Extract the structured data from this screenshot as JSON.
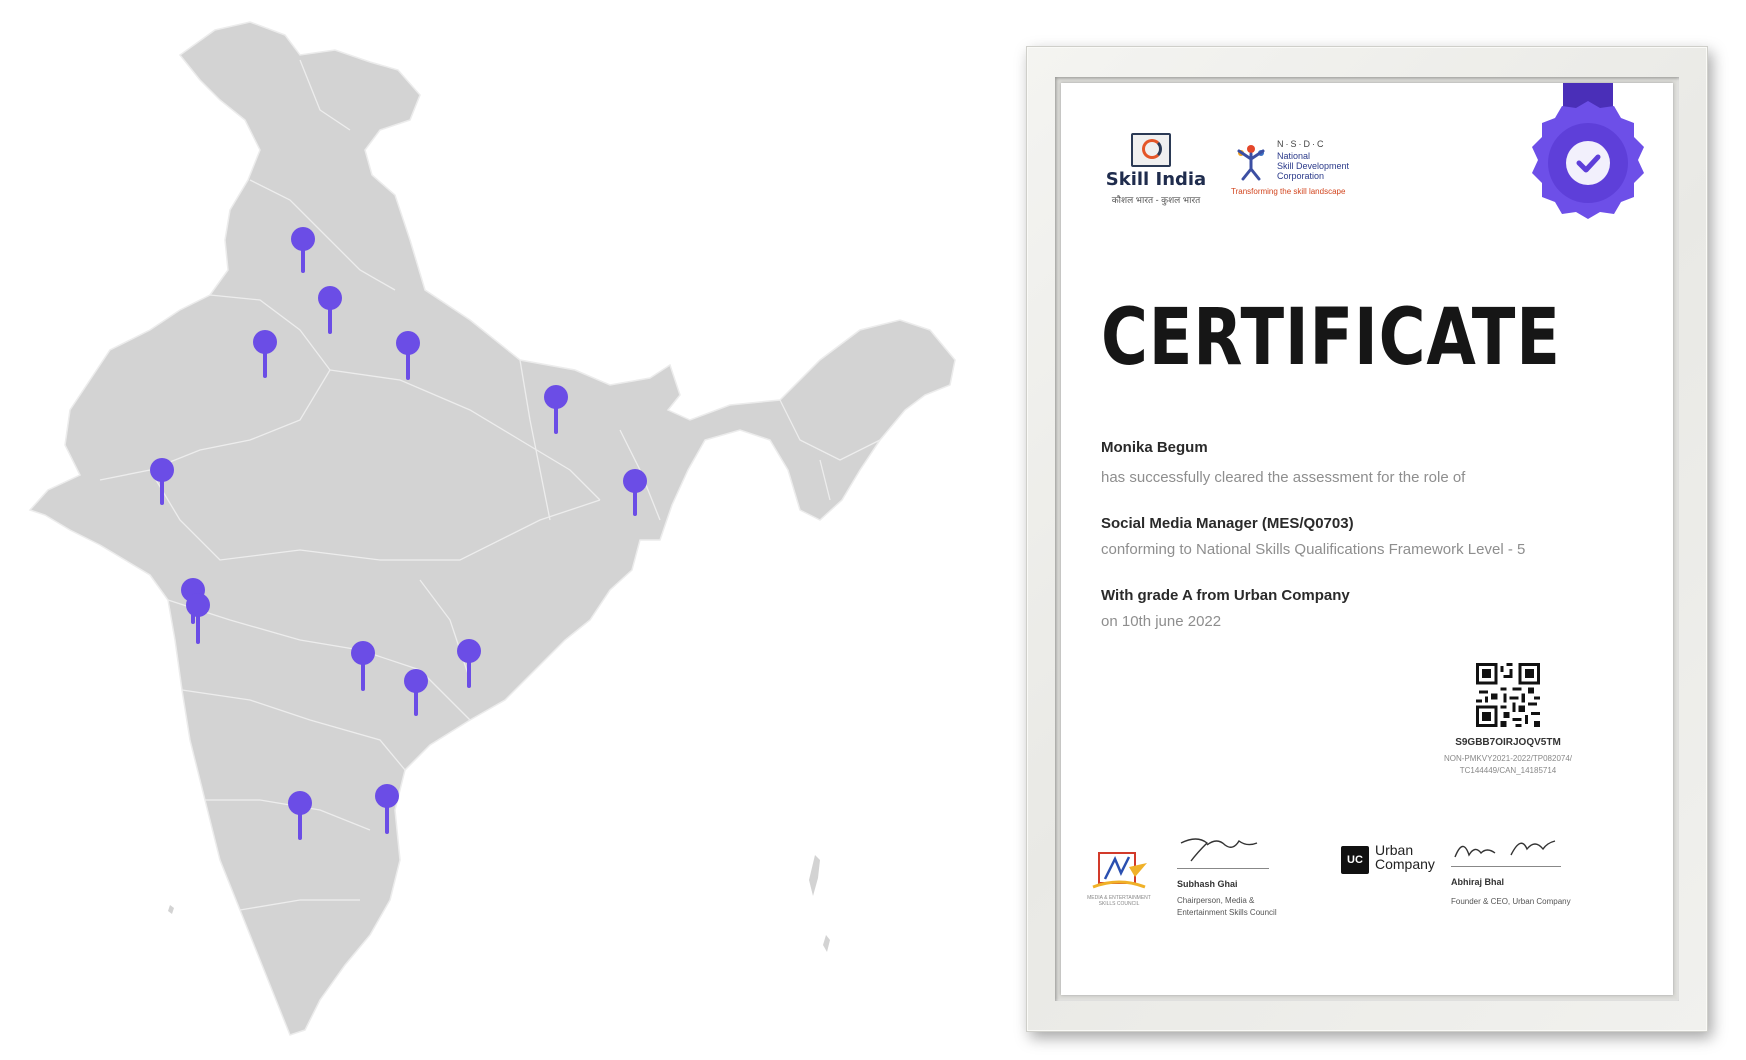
{
  "certificate": {
    "skill_india": {
      "name": "Skill India",
      "tagline": "कौशल भारत - कुशल भारत"
    },
    "nsdc": {
      "acronym": "N·S·D·C",
      "line1": "National",
      "line2": "Skill Development",
      "line3": "Corporation",
      "tagline": "Transforming the skill landscape"
    },
    "title": "CERTIFICATE",
    "candidate": "Monika Begum",
    "cleared_text": "has successfully cleared the assessment for the role of",
    "role": "Social Media Manager (MES/Q0703)",
    "framework_text": "conforming to National Skills Qualifications Framework Level - 5",
    "grade_text": "With grade A from Urban Company",
    "date_text": "on 10th june 2022",
    "code": "S9GBB7OIRJOQV5TM",
    "reference_line1": "NON-PMKVY2021-2022/TP082074/",
    "reference_line2": "TC144449/CAN_14185714",
    "mesc_text": "MEDIA & ENTERTAINMENT SKILLS COUNCIL",
    "signatory1": {
      "name": "Subhash Ghai",
      "role_line1": "Chairperson, Media &",
      "role_line2": "Entertainment Skills Council"
    },
    "urban_company": {
      "box": "UC",
      "line1": "Urban",
      "line2": "Company"
    },
    "signatory2": {
      "name": "Abhiraj Bhal",
      "role": "Founder & CEO, Urban Company"
    },
    "badge_color": "#6d4fe8"
  },
  "map": {
    "land_color": "#d3d3d3",
    "pin_color": "#6b4de6",
    "pin_icon": "map-pin-icon",
    "pin_count": 15
  }
}
